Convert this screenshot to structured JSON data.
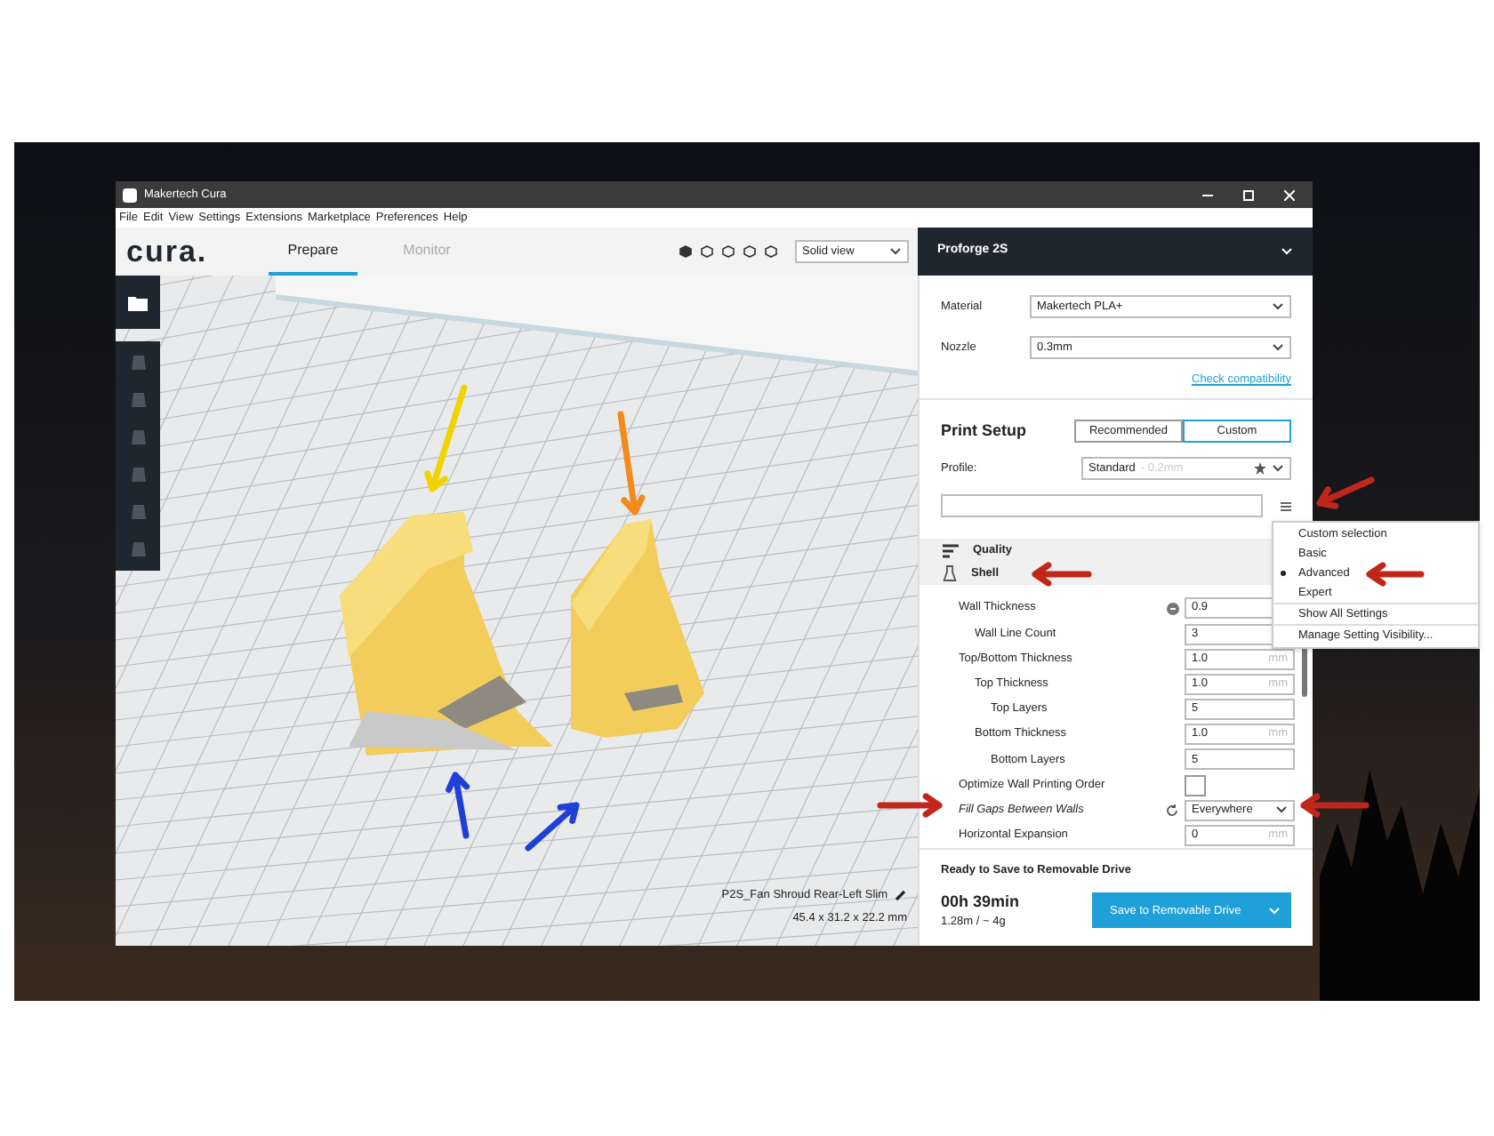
{
  "window": {
    "title": "Makertech Cura"
  },
  "menu_bar": [
    "File",
    "Edit",
    "View",
    "Settings",
    "Extensions",
    "Marketplace",
    "Preferences",
    "Help"
  ],
  "header": {
    "logo": "cura.",
    "tabs": [
      {
        "label": "Prepare",
        "selected": true
      },
      {
        "label": "Monitor",
        "selected": false
      }
    ],
    "view_mode": "Solid view",
    "printer": "Proforge 2S"
  },
  "viewport": {
    "object_name": "P2S_Fan Shroud Rear-Left Slim",
    "object_size": "45.4 x 31.2 x 22.2 mm"
  },
  "sidebar": {
    "material_label": "Material",
    "material": "Makertech PLA+",
    "nozzle_label": "Nozzle",
    "nozzle": "0.3mm",
    "compat_link": "Check compatibility",
    "print_setup_title": "Print Setup",
    "modes": [
      {
        "label": "Recommended",
        "selected": false
      },
      {
        "label": "Custom",
        "selected": true
      }
    ],
    "profile_label": "Profile:",
    "profile": "Standard",
    "profile_detail": "- 0.2mm",
    "categories": [
      {
        "label": "Quality",
        "kind": "quality"
      },
      {
        "label": "Shell",
        "kind": "shell"
      }
    ],
    "settings": [
      {
        "label": "Wall Thickness",
        "kind": "number",
        "value": "0.9",
        "linked": true,
        "modified": false,
        "children": [
          {
            "label": "Wall Line Count",
            "kind": "number",
            "value": "3",
            "linked": false,
            "modified": false
          }
        ]
      },
      {
        "label": "Top/Bottom Thickness",
        "kind": "number",
        "value": "1.0",
        "unit": "mm",
        "linked": false,
        "modified": false,
        "children": [
          {
            "label": "Top Thickness",
            "kind": "number",
            "value": "1.0",
            "unit": "mm",
            "linked": false,
            "modified": false,
            "children": [
              {
                "label": "Top Layers",
                "kind": "number",
                "value": "5",
                "linked": false,
                "modified": false
              }
            ]
          },
          {
            "label": "Bottom Thickness",
            "kind": "number",
            "value": "1.0",
            "unit": "mm",
            "linked": false,
            "modified": false,
            "children": [
              {
                "label": "Bottom Layers",
                "kind": "number",
                "value": "5",
                "linked": false,
                "modified": false
              }
            ]
          }
        ]
      },
      {
        "label": "Optimize Wall Printing Order",
        "kind": "checkbox",
        "checked": false,
        "linked": false,
        "modified": false
      },
      {
        "label": "Fill Gaps Between Walls",
        "kind": "select",
        "value": "Everywhere",
        "linked": false,
        "modified": true
      },
      {
        "label": "Horizontal Expansion",
        "kind": "number",
        "value": "0",
        "unit": "mm",
        "linked": false,
        "modified": false
      }
    ]
  },
  "visibility_menu": [
    {
      "label": "Custom selection",
      "kind": "option",
      "selected": false
    },
    {
      "label": "Basic",
      "kind": "option",
      "selected": false
    },
    {
      "label": "Advanced",
      "kind": "option",
      "selected": true
    },
    {
      "label": "Expert",
      "kind": "option",
      "selected": false
    },
    {
      "label": "Show All Settings",
      "kind": "action"
    },
    {
      "label": "Manage Setting Visibility...",
      "kind": "action"
    }
  ],
  "footer": {
    "status": "Ready to Save to Removable Drive",
    "time": "00h 39min",
    "material_use": "1.28m / ~ 4g",
    "save_button": "Save to Removable Drive"
  }
}
